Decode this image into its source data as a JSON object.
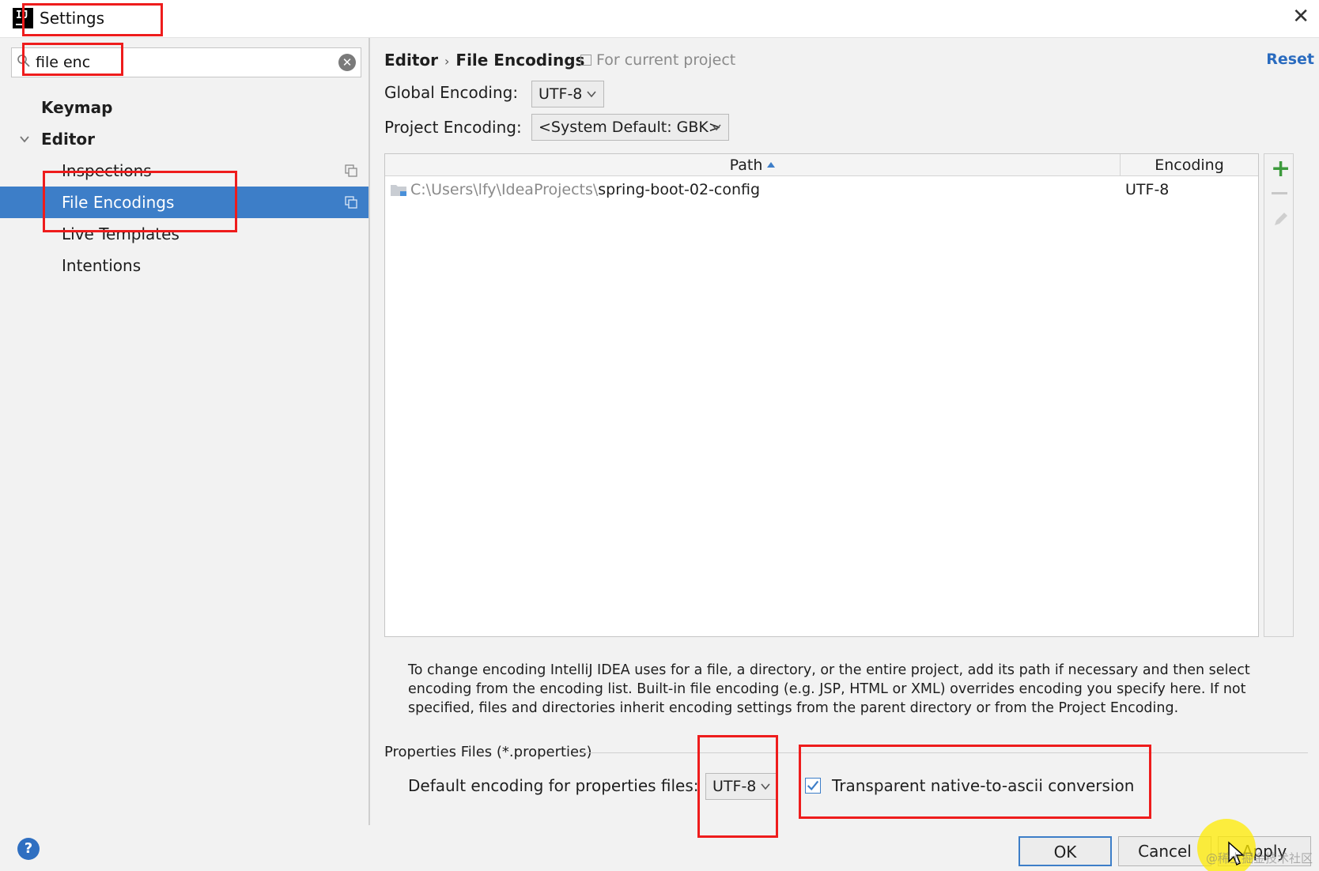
{
  "window": {
    "title": "Settings",
    "close_icon": "close-icon"
  },
  "colors": {
    "selection": "#3d7ec8",
    "link": "#2a6bbf",
    "annotation": "#ee1c1c",
    "add_green": "#3d9a3d"
  },
  "search": {
    "value": "file enc"
  },
  "sidebar": {
    "keymap": "Keymap",
    "editor": "Editor",
    "inspections": "Inspections",
    "file_encodings": "File Encodings",
    "live_templates": "Live Templates",
    "intentions": "Intentions"
  },
  "header": {
    "crumb_parent": "Editor",
    "crumb_sep": "›",
    "crumb_current": "File Encodings",
    "scope": "For current project",
    "reset": "Reset"
  },
  "form": {
    "global_label": "Global Encoding:",
    "global_value": "UTF-8",
    "project_label": "Project Encoding:",
    "project_value": "<System Default: GBK>"
  },
  "table": {
    "col_path": "Path",
    "col_encoding": "Encoding",
    "rows": [
      {
        "path_prefix": "C:\\Users\\lfy\\IdeaProjects\\",
        "path_name": "spring-boot-02-config",
        "encoding": "UTF-8"
      }
    ]
  },
  "hint": "To change encoding IntelliJ IDEA uses for a file, a directory, or the entire project, add its path if necessary and then select encoding from the encoding list. Built-in file encoding (e.g. JSP, HTML or XML) overrides encoding you specify here. If not specified, files and directories inherit encoding settings from the parent directory or from the Project Encoding.",
  "properties": {
    "section_title": "Properties Files (*.properties)",
    "default_label": "Default encoding for properties files:",
    "default_value": "UTF-8",
    "native_ascii_label": "Transparent native-to-ascii conversion",
    "native_ascii_checked": true
  },
  "buttons": {
    "ok": "OK",
    "cancel": "Cancel",
    "apply": "Apply",
    "help": "?"
  },
  "watermark": "@稀土掘金技术社区"
}
